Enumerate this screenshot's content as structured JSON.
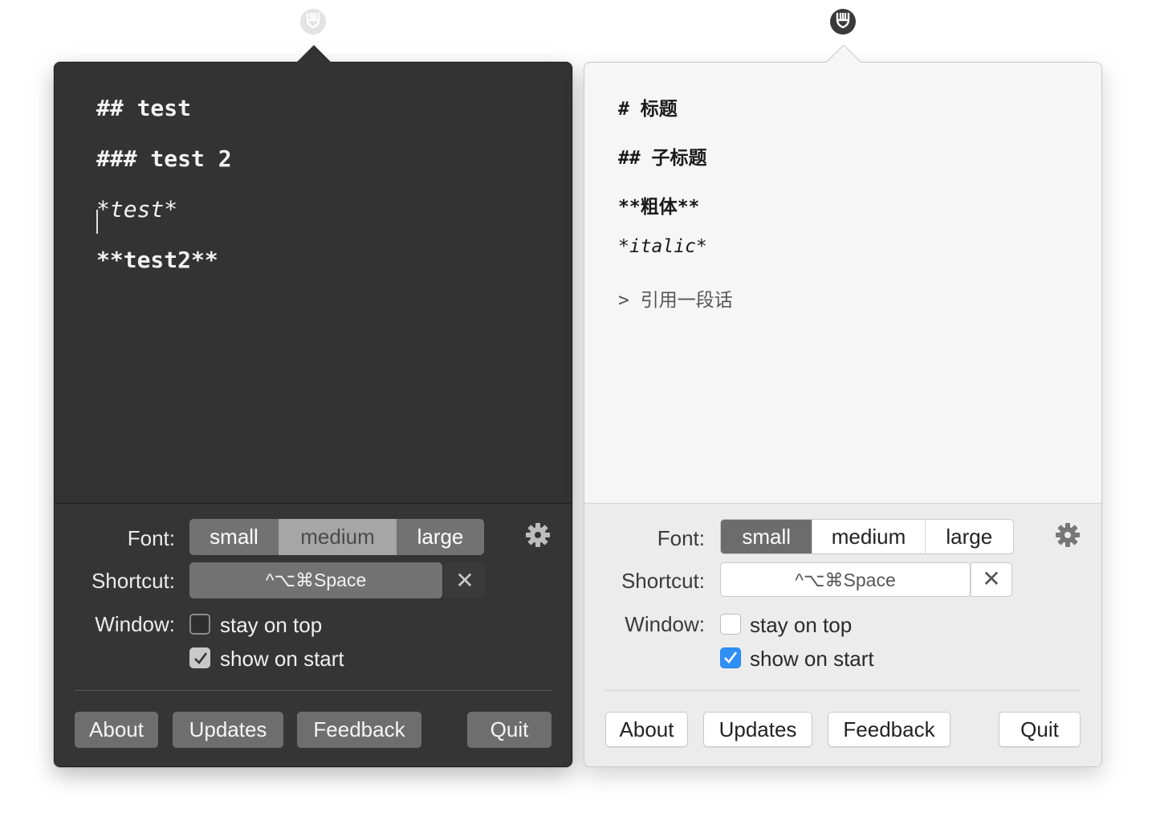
{
  "dark_panel": {
    "theme": "dark",
    "editor_lines": [
      "## test",
      "### test 2",
      "*test*",
      "**test2**"
    ],
    "settings": {
      "font_label": "Font:",
      "font_options": [
        "small",
        "medium",
        "large"
      ],
      "font_selected": "medium",
      "shortcut_label": "Shortcut:",
      "shortcut_value": "^⌥⌘Space",
      "window_label": "Window:",
      "stay_on_top_label": "stay on top",
      "stay_on_top_checked": false,
      "show_on_start_label": "show on start",
      "show_on_start_checked": true
    },
    "buttons": {
      "about": "About",
      "updates": "Updates",
      "feedback": "Feedback",
      "quit": "Quit"
    }
  },
  "light_panel": {
    "theme": "light",
    "editor_lines": [
      "# 标题",
      "## 子标题",
      "**粗体**",
      "*italic*",
      "> 引用一段话"
    ],
    "settings": {
      "font_label": "Font:",
      "font_options": [
        "small",
        "medium",
        "large"
      ],
      "font_selected": "small",
      "shortcut_label": "Shortcut:",
      "shortcut_value": "^⌥⌘Space",
      "window_label": "Window:",
      "stay_on_top_label": "stay on top",
      "stay_on_top_checked": false,
      "show_on_start_label": "show on start",
      "show_on_start_checked": true
    },
    "buttons": {
      "about": "About",
      "updates": "Updates",
      "feedback": "Feedback",
      "quit": "Quit"
    }
  },
  "icons": {
    "menubar": "menubar-app-icon",
    "gear": "gear-icon",
    "clear": "close-icon",
    "check": "checkmark-icon"
  },
  "colors": {
    "dark_bg": "#333333",
    "light_bg": "#f5f5f5",
    "accent_blue": "#2f8ff7"
  },
  "clear_glyph": "✕"
}
